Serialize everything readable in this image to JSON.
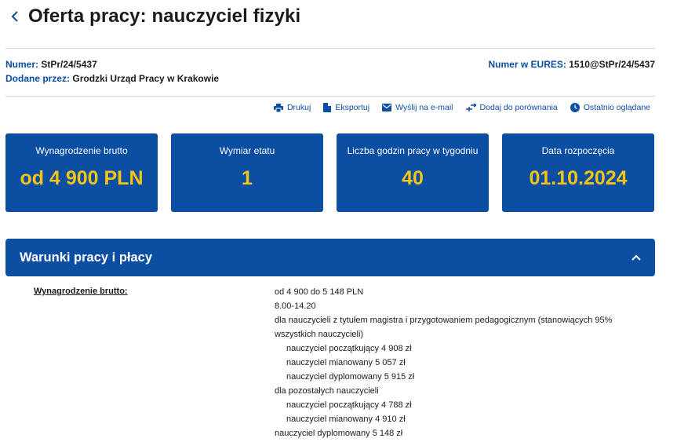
{
  "header": {
    "title": "Oferta pracy: nauczyciel fizyki"
  },
  "meta": {
    "number_label": "Numer:",
    "number_value": "StPr/24/5437",
    "added_label": "Dodane przez:",
    "added_value": "Grodzki Urząd Pracy w Krakowie",
    "eures_label": "Numer w EURES:",
    "eures_value": "1510@StPr/24/5437"
  },
  "actions": [
    {
      "label": "Drukuj",
      "icon": "printer-icon"
    },
    {
      "label": "Eksportuj",
      "icon": "document-icon"
    },
    {
      "label": "Wyślij na e-mail",
      "icon": "envelope-icon"
    },
    {
      "label": "Dodaj do porównania",
      "icon": "compare-icon"
    },
    {
      "label": "Ostatnio oglądane",
      "icon": "clock-icon"
    }
  ],
  "cards": [
    {
      "label": "Wynagrodzenie brutto",
      "value": "od 4 900 PLN"
    },
    {
      "label": "Wymiar etatu",
      "value": "1"
    },
    {
      "label": "Liczba godzin pracy w tygodniu",
      "value": "40"
    },
    {
      "label": "Data rozpoczęcia",
      "value": "01.10.2024"
    }
  ],
  "section": {
    "title": "Warunki pracy i płacy"
  },
  "details": {
    "label": "Wynagrodzenie brutto:",
    "lines": [
      "od 4 900 do 5 148 PLN",
      "8.00-14.20",
      "dla nauczycieli z tytułem magistra i przygotowaniem pedagogicznym (stanowiących 95% wszystkich nauczycieli)",
      "nauczyciel początkujący  4 908 zł",
      "nauczyciel mianowany  5 057 zł",
      "nauczyciel dyplomowany  5 915 zł",
      "dla pozostałych nauczycieli",
      "nauczyciel początkujący  4 788 zł",
      "nauczyciel mianowany  4 910 zł",
      "nauczyciel dyplomowany  5 148 zł"
    ]
  },
  "colors": {
    "primary": "#0b4ea2",
    "accent": "#f6c414"
  }
}
